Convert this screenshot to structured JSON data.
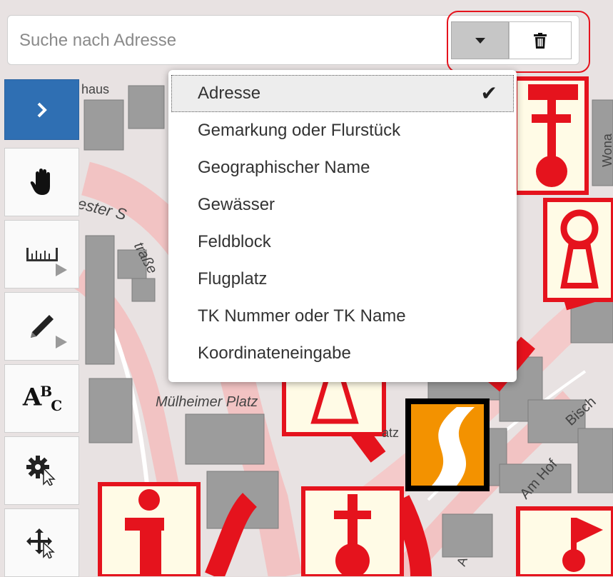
{
  "search": {
    "placeholder": "Suche nach Adresse",
    "dropdown_icon": "caret-down-icon",
    "clear_icon": "trash-icon"
  },
  "dropdown_menu": {
    "items": [
      {
        "label": "Adresse",
        "selected": true
      },
      {
        "label": "Gemarkung oder Flurstück",
        "selected": false
      },
      {
        "label": "Geographischer Name",
        "selected": false
      },
      {
        "label": "Gewässer",
        "selected": false
      },
      {
        "label": "Feldblock",
        "selected": false
      },
      {
        "label": "Flugplatz",
        "selected": false
      },
      {
        "label": "TK Nummer oder TK Name",
        "selected": false
      },
      {
        "label": "Koordinateneingabe",
        "selected": false
      }
    ],
    "check_mark": "✔"
  },
  "toolbar": {
    "tools": [
      {
        "name": "expand-toolbar",
        "icon": "chevron-right-icon"
      },
      {
        "name": "pan",
        "icon": "hand-icon"
      },
      {
        "name": "measure",
        "icon": "ruler-icon"
      },
      {
        "name": "draw",
        "icon": "pencil-icon"
      },
      {
        "name": "text-annotation",
        "icon": "abc-icon",
        "text": "A B C"
      },
      {
        "name": "settings",
        "icon": "gear-cursor-icon"
      },
      {
        "name": "move",
        "icon": "move-arrows-icon"
      }
    ]
  },
  "map": {
    "labels": {
      "top_left": "haus",
      "street_left": "ester S",
      "street_diag": "traße",
      "square": "Mülheimer Platz",
      "square_small": "atz",
      "am_hof": "Am Hof",
      "bisch": "Bisch",
      "right_vertical": "Wona",
      "bottom": "A"
    },
    "colors": {
      "poi_red": "#e5131d",
      "poi_fill": "#fffbe6",
      "building": "#9c9c9c",
      "road_pink": "#f3c6c6",
      "logo_orange": "#f39200"
    }
  }
}
